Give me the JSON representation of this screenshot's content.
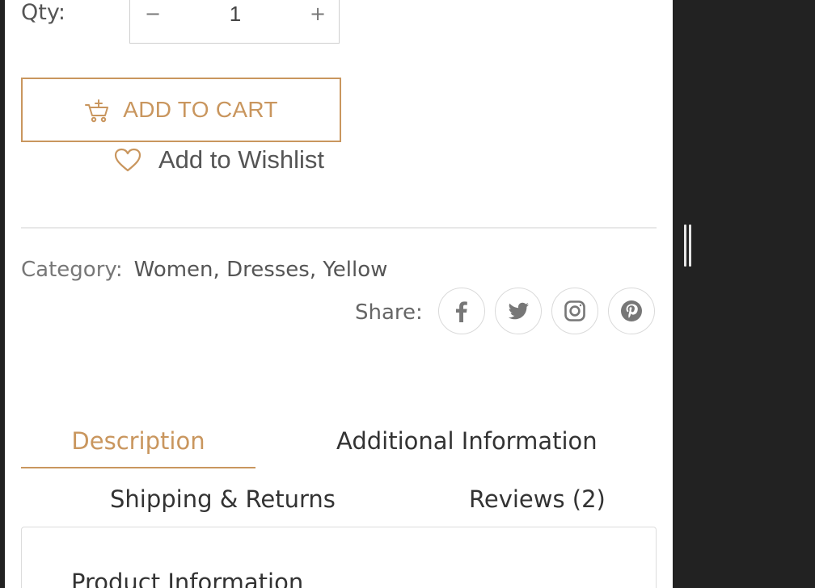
{
  "product": {
    "qty_label": "Qty:",
    "qty_minus": "−",
    "qty_value": "1",
    "qty_plus": "+",
    "add_to_cart_label": "ADD TO CART",
    "wishlist_label": "Add to Wishlist"
  },
  "meta": {
    "category_label": "Category:",
    "category_values": "Women, Dresses, Yellow",
    "share_label": "Share:",
    "share_icons": [
      "facebook-icon",
      "twitter-icon",
      "instagram-icon",
      "pinterest-icon"
    ]
  },
  "tabs": {
    "description": "Description",
    "additional_information": "Additional Information",
    "shipping_returns": "Shipping & Returns",
    "reviews": "Reviews (2)",
    "active": "Description"
  },
  "content": {
    "heading": "Product Information"
  },
  "colors": {
    "accent": "#c9965e",
    "dark_panel": "#222222",
    "text": "#555555"
  }
}
